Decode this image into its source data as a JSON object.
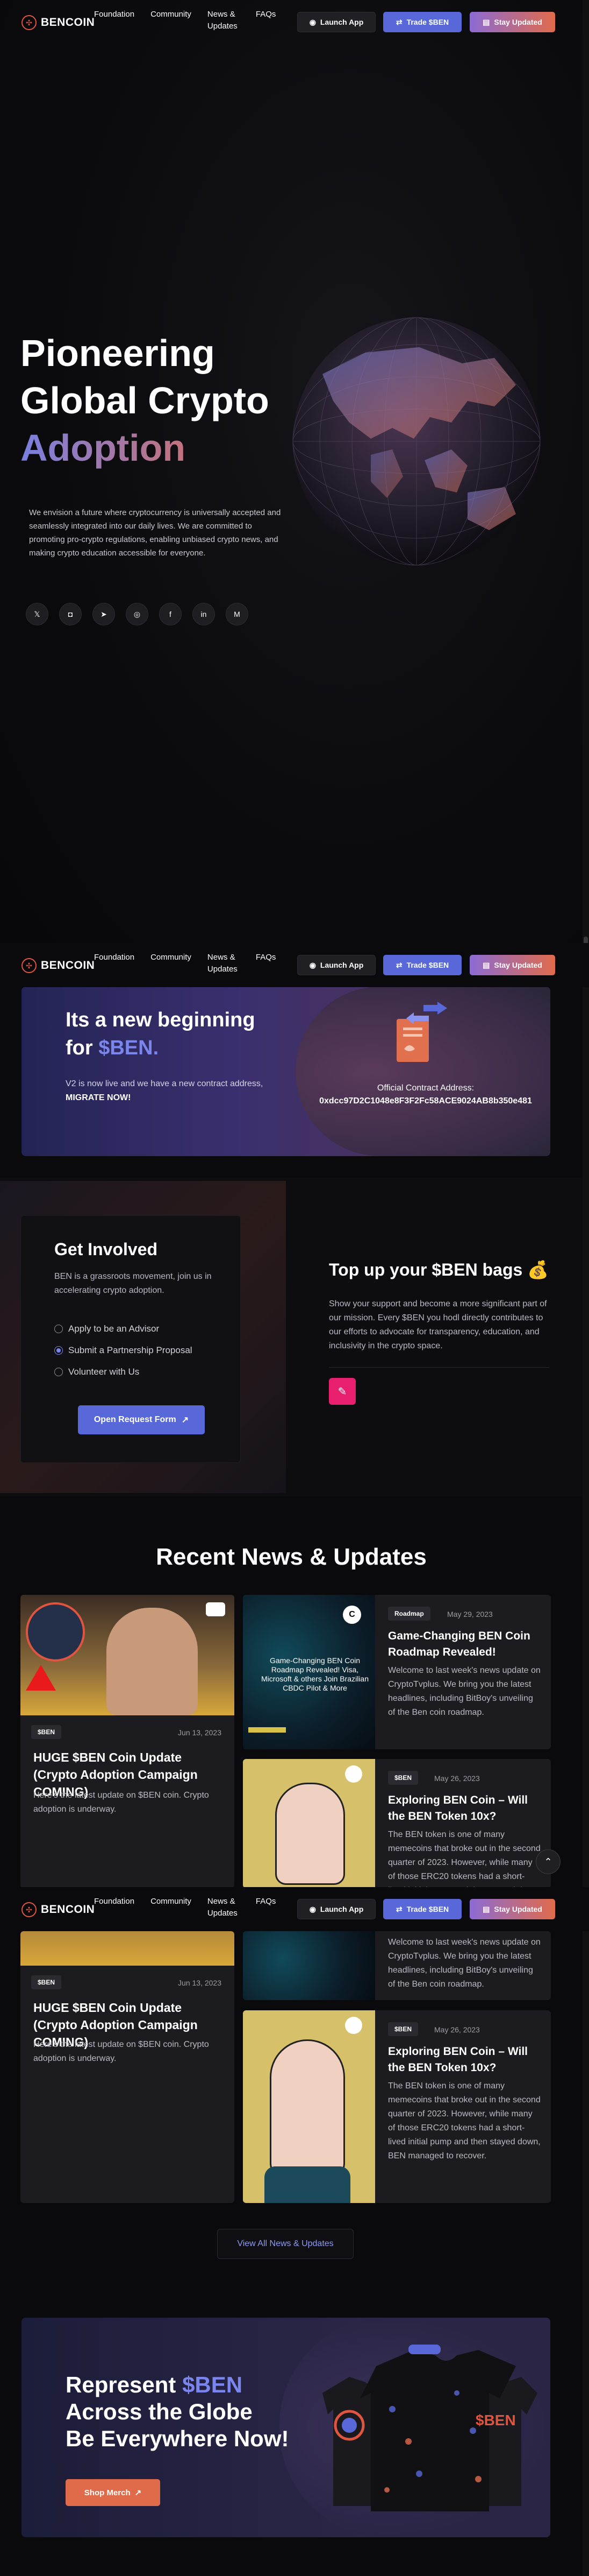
{
  "brand": {
    "logo_text": "BENCOIN",
    "accent": "#5868d8",
    "accent_warm": "#e06b4b"
  },
  "nav": {
    "menu": [
      "Foundation",
      "Community",
      "News & Updates",
      "FAQs"
    ],
    "launch_label": "Launch App",
    "trade_label": "Trade $BEN",
    "stay_label": "Stay Updated"
  },
  "hero": {
    "title_line1": "Pioneering",
    "title_line2": "Global Crypto",
    "title_line3": "Adoption",
    "description": "We envision a future where cryptocurrency is universally accepted and seamlessly integrated into our daily lives. We are committed to promoting pro-crypto regulations, enabling unbiased crypto news, and making crypto education accessible for everyone.",
    "socials": [
      "X",
      "Discord",
      "Telegram",
      "Instagram",
      "Facebook",
      "LinkedIn",
      "Medium"
    ]
  },
  "contract": {
    "title_part1": "Its a new beginning",
    "title_part2": "for ",
    "title_accent": "$BEN.",
    "desc_text": "V2 is now live and we have a new contract address, ",
    "desc_bold": "MIGRATE NOW!",
    "address_label": "Official Contract Address:",
    "address": "0xdcc97D2C1048e8F3F2Fc58ACE9024AB8b350e481"
  },
  "involved": {
    "title": "Get Involved",
    "subtitle": "BEN is a grassroots movement, join us in accelerating crypto adoption.",
    "options": [
      {
        "label": "Apply to be an Advisor",
        "selected": false
      },
      {
        "label": "Submit a Partnership Proposal",
        "selected": true
      },
      {
        "label": "Volunteer with Us",
        "selected": false
      }
    ],
    "button": "Open Request Form"
  },
  "topup": {
    "title": "Top up your $BEN bags 💰",
    "description": "Show your support and become a more significant part of our mission. Every $BEN you hodl directly contributes to our efforts to advocate for transparency, education, and inclusivity in the crypto space."
  },
  "news": {
    "heading": "Recent News & Updates",
    "featured": {
      "tag": "$BEN",
      "date": "Jun 13, 2023",
      "title": "HUGE $BEN Coin Update (Crypto Adoption Campaign COMING)",
      "body": "Here's the latest update on $BEN coin. Crypto adoption is underway."
    },
    "items": [
      {
        "tag": "Roadmap",
        "date": "May 29, 2023",
        "title": "Game-Changing BEN Coin Roadmap Revealed!",
        "body": "Welcome to last week's news update on CryptoTvplus. We bring you the latest headlines, including BitBoy's unveiling of the Ben coin roadmap.",
        "thumb_text": "Game-Changing BEN Coin Roadmap Revealed! Visa, Microsoft & others Join Brazilian CBDC Pilot & More"
      },
      {
        "tag": "$BEN",
        "date": "May 26, 2023",
        "title": "Exploring BEN Coin – Will the BEN Token 10x?",
        "body": "The BEN token is one of many memecoins that broke out in the second quarter of 2023. However, while many of those ERC20 tokens had a short-lived initial pump and then stayed down, BEN managed to recover."
      }
    ],
    "view_all": "View All News & Updates"
  },
  "merch": {
    "line1": "Represent ",
    "line1_accent": "$BEN",
    "line2": "Across the Globe",
    "line3": "Be Everywhere Now!",
    "button": "Shop Merch",
    "shirt_text": "$BEN"
  }
}
